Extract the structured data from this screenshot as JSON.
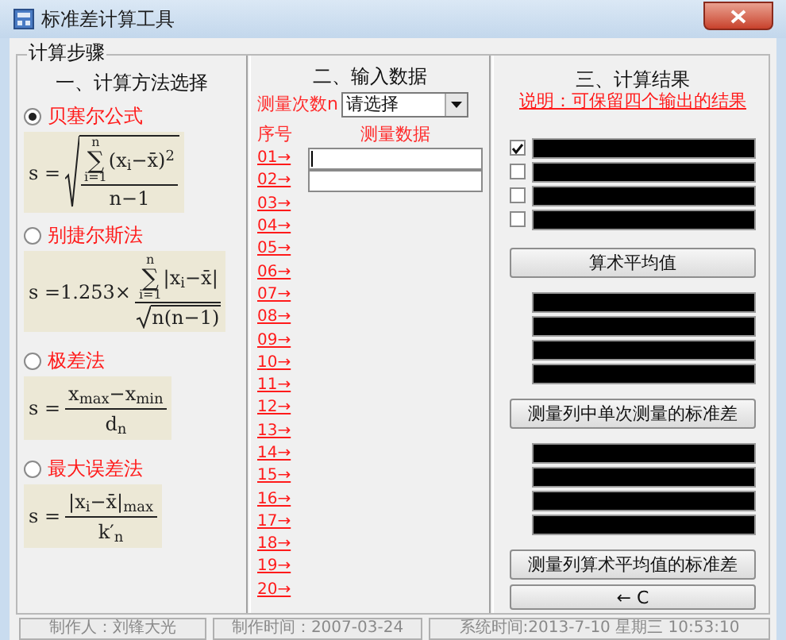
{
  "window": {
    "title": "标准差计算工具"
  },
  "group_title": "计算步骤",
  "methods": {
    "heading": "一、计算方法选择",
    "items": [
      {
        "label": "贝塞尔公式",
        "selected": true,
        "formula": {
          "kind": "sqrt_of_fraction",
          "lhs": "s =",
          "sum": {
            "upper": "n",
            "symbol": "∑",
            "lower": "i=1"
          },
          "numerator": "(x$_{i}$−x̄)$^{2}$",
          "denominator": "n−1"
        }
      },
      {
        "label": "别捷尔斯法",
        "selected": false,
        "formula": {
          "kind": "fraction_sqrt_denominator",
          "lhs": "s =1.253×",
          "sum": {
            "upper": "n",
            "symbol": "∑",
            "lower": "i=1"
          },
          "numerator": "|x$_{i}$−x̄|",
          "denominator": "n(n−1)"
        }
      },
      {
        "label": "极差法",
        "selected": false,
        "formula": {
          "kind": "fraction",
          "lhs": "s =",
          "numerator": "x$_{max}$−x$_{min}$",
          "denominator": "d$_{n}$"
        }
      },
      {
        "label": "最大误差法",
        "selected": false,
        "formula": {
          "kind": "fraction",
          "lhs": "s =",
          "numerator": "|x$_{i}$−x̄|$_{max}$",
          "denominator": "k′$_{n}$"
        }
      }
    ]
  },
  "input": {
    "heading": "二、输入数据",
    "count_label": "测量次数n",
    "count_select": "请选择",
    "index_header": "序号",
    "data_header": "测量数据",
    "rows": [
      "01→",
      "02→",
      "03→",
      "04→",
      "05→",
      "06→",
      "07→",
      "08→",
      "09→",
      "10→",
      "11→",
      "12→",
      "13→",
      "14→",
      "15→",
      "16→",
      "17→",
      "18→",
      "19→",
      "20→"
    ],
    "fields": [
      {
        "focused": true
      },
      {
        "focused": false
      }
    ]
  },
  "results": {
    "heading": "三、计算结果",
    "note": "说明：可保留四个输出的结果",
    "retain_checks": [
      {
        "checked": true
      },
      {
        "checked": false
      },
      {
        "checked": false
      },
      {
        "checked": false
      }
    ],
    "buttons": [
      "算术平均值",
      "测量列中单次测量的标准差",
      "测量列算术平均值的标准差"
    ],
    "clear_button": "← C"
  },
  "status_bar": [
    "制作人：刘锋大光",
    "制作时间：2007-03-24",
    "系统时间:2013-7-10 星期三 10:53:10"
  ]
}
